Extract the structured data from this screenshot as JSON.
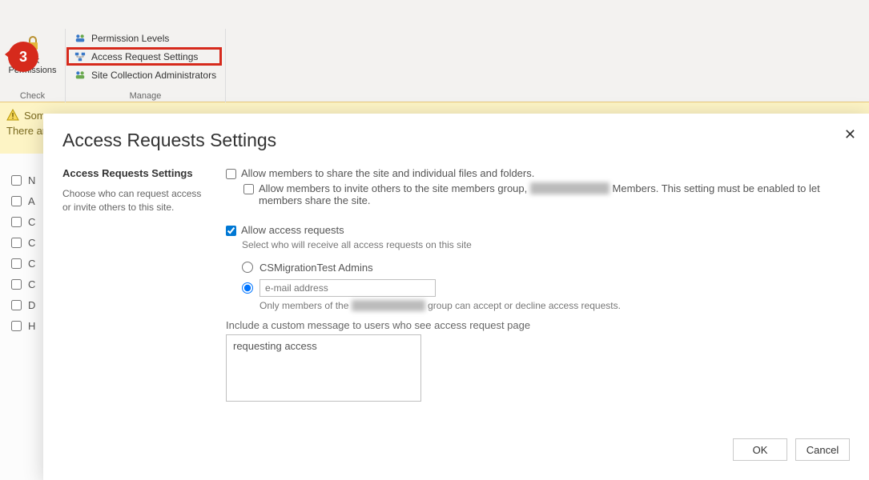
{
  "step_badge": "3",
  "ribbon": {
    "check": {
      "button_line1": "eck",
      "button_line2": "Permissions",
      "group_label": "Check"
    },
    "manage": {
      "items": [
        "Permission Levels",
        "Access Request Settings",
        "Site Collection Administrators"
      ],
      "group_label": "Manage"
    }
  },
  "warning": {
    "line1": "Som",
    "line2": "There are"
  },
  "bg_list": [
    "N",
    "A",
    "C",
    "C",
    "C",
    "C",
    "D",
    "H"
  ],
  "modal": {
    "title": "Access Requests Settings",
    "left_heading": "Access Requests Settings",
    "left_desc": "Choose who can request access or invite others to this site.",
    "chk_share": {
      "checked": false,
      "label": "Allow members to share the site and individual files and folders."
    },
    "chk_invite": {
      "checked": false,
      "label_pre": "Allow members to invite others to the site members group, ",
      "label_post": " Members. This setting must be enabled to let members share the site."
    },
    "chk_allow": {
      "checked": true,
      "label": "Allow access requests"
    },
    "select_hint": "Select who will receive all access requests on this site",
    "radio_admins": {
      "selected": false,
      "label": "CSMigrationTest Admins"
    },
    "radio_email": {
      "selected": true,
      "placeholder": "e-mail address",
      "value": ""
    },
    "only_members_pre": "Only members of the ",
    "only_members_post": " group can accept or decline access requests.",
    "msg_label": "Include a custom message to users who see access request page",
    "msg_value": "requesting access",
    "ok": "OK",
    "cancel": "Cancel"
  }
}
